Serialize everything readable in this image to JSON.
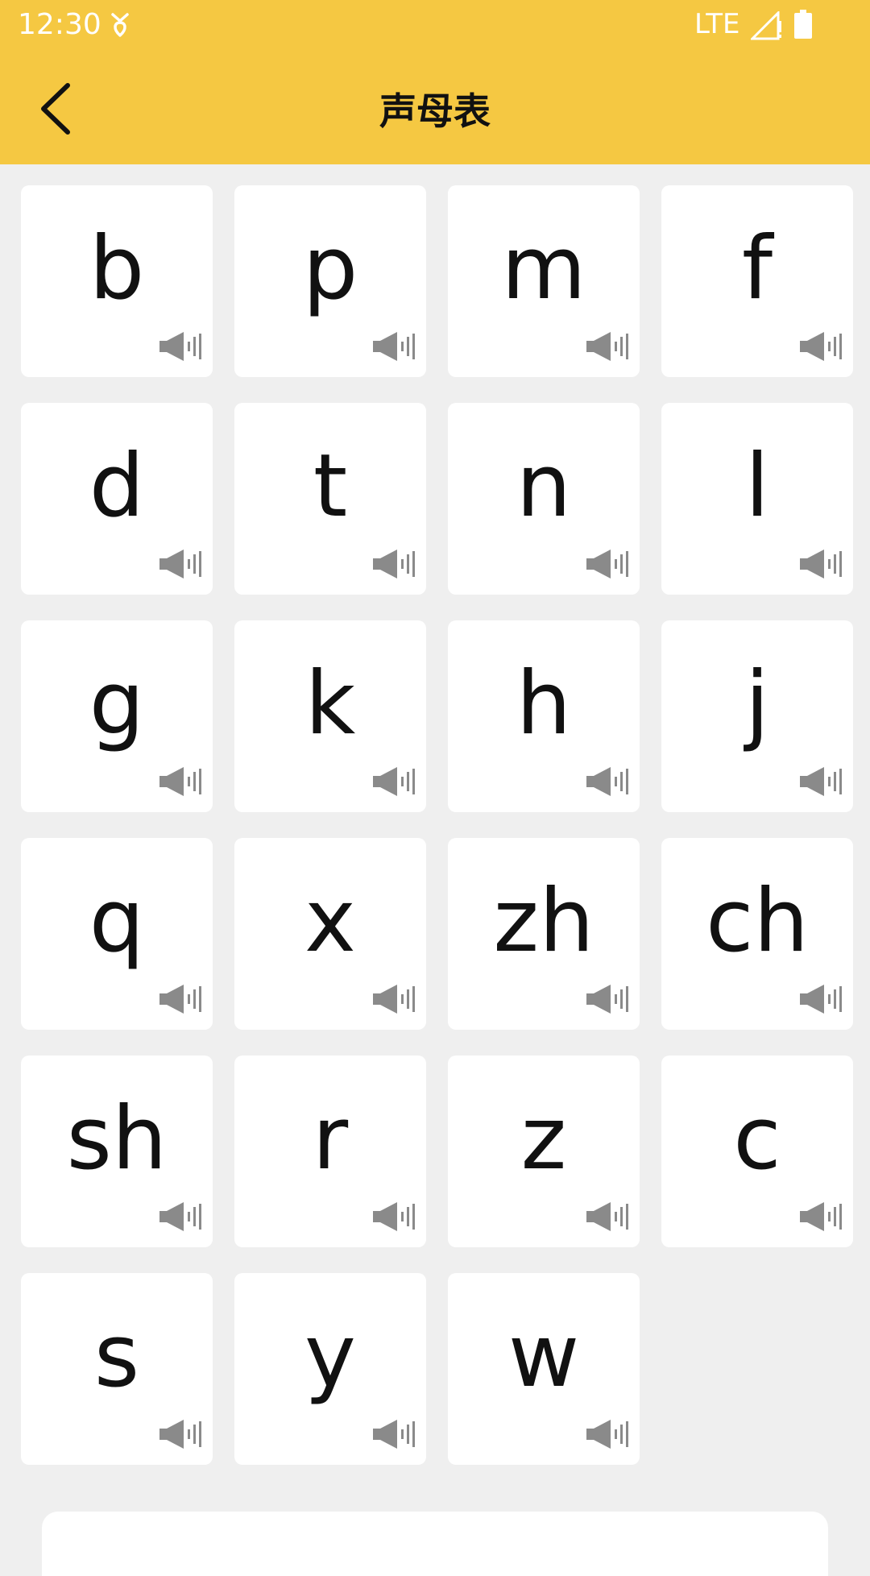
{
  "status_bar": {
    "time": "12:30",
    "network": "LTE",
    "icons": [
      "notification-icon",
      "signal-icon",
      "battery-icon"
    ]
  },
  "app_bar": {
    "title": "声母表",
    "back_icon": "chevron-left-icon"
  },
  "colors": {
    "accent": "#f5c842",
    "background": "#efefef",
    "card": "#ffffff",
    "text": "#111111",
    "speaker": "#8a8a8a"
  },
  "initials": [
    "b",
    "p",
    "m",
    "f",
    "d",
    "t",
    "n",
    "l",
    "g",
    "k",
    "h",
    "j",
    "q",
    "x",
    "zh",
    "ch",
    "sh",
    "r",
    "z",
    "c",
    "s",
    "y",
    "w"
  ],
  "card_icon": "speaker-icon"
}
